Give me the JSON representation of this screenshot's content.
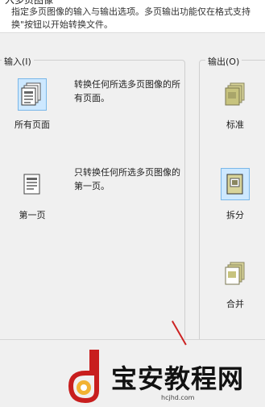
{
  "header": {
    "title": "入多页图像",
    "description": "指定多页图像的输入与输出选项。多页输出功能仅在格式支持 换\"按钮以开始转换文件。"
  },
  "input_group": {
    "label": "输入(I)",
    "options": [
      {
        "label": "所有页面",
        "description": "转换任何所选多页图像的所有页面。",
        "selected": true,
        "icon": "all-pages-icon"
      },
      {
        "label": "第一页",
        "description": "只转换任何所选多页图像的第一页。",
        "selected": false,
        "icon": "first-page-icon"
      }
    ]
  },
  "output_group": {
    "label": "输出(O)",
    "options": [
      {
        "label": "标准",
        "selected": false,
        "icon": "standard-output-icon"
      },
      {
        "label": "拆分",
        "selected": true,
        "icon": "split-output-icon"
      },
      {
        "label": "合并",
        "selected": false,
        "icon": "merge-output-icon"
      }
    ]
  },
  "watermark": {
    "name": "宝安教程网",
    "url": "hcjhd.com"
  },
  "colors": {
    "selection_bg": "#cde8ff",
    "selection_border": "#7ab7e8",
    "panel_bg": "#f0f0f0",
    "annotation_red": "#cc2222"
  }
}
